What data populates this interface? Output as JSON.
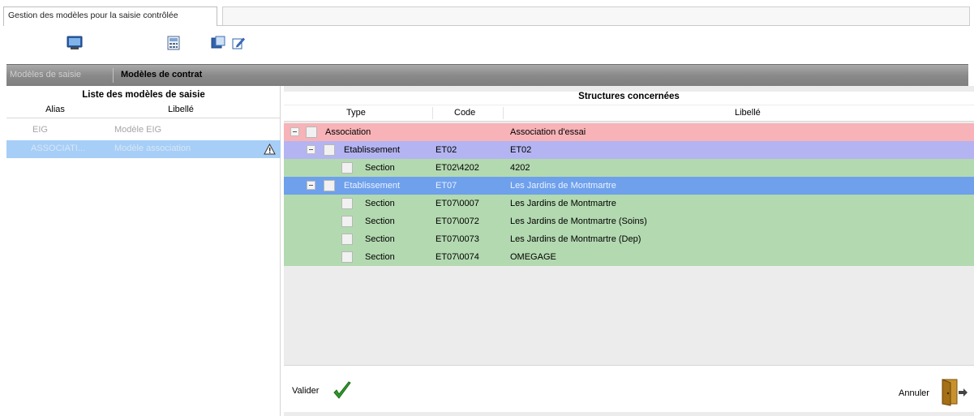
{
  "window": {
    "title": "Gestion des modèles pour la saisie contrôlée"
  },
  "toolbar": {
    "icons": [
      "monitor-icon",
      "calculator-icon",
      "window-icon",
      "edit-icon"
    ]
  },
  "tabs": [
    {
      "label": "Modèles de saisie",
      "active": false
    },
    {
      "label": "Modèles de contrat",
      "active": true
    }
  ],
  "left_panel": {
    "title": "Liste des modèles de saisie",
    "columns": [
      "Alias",
      "Libellé"
    ],
    "rows": [
      {
        "alias": "EIG",
        "libelle": "Modèle EIG",
        "selected": false
      },
      {
        "alias": "ASSOCIATI...",
        "libelle": "Modèle association",
        "selected": true,
        "warning": true
      }
    ]
  },
  "right_panel": {
    "title": "Structures  concernées",
    "columns": [
      "Type",
      "Code",
      "Libellé"
    ],
    "rows": [
      {
        "level": 0,
        "type": "Association",
        "code": "",
        "libelle": "Association d'essai",
        "kind": "assoc",
        "expander": true
      },
      {
        "level": 1,
        "type": "Etablissement",
        "code": "ET02",
        "libelle": "ET02",
        "kind": "etab",
        "expander": true
      },
      {
        "level": 2,
        "type": "Section",
        "code": "ET02\\4202",
        "libelle": "4202",
        "kind": "sect",
        "expander": false
      },
      {
        "level": 1,
        "type": "Etablissement",
        "code": "ET07",
        "libelle": "Les Jardins de Montmartre",
        "kind": "sel",
        "expander": true
      },
      {
        "level": 2,
        "type": "Section",
        "code": "ET07\\0007",
        "libelle": "Les Jardins de Montmartre",
        "kind": "sect",
        "expander": false
      },
      {
        "level": 2,
        "type": "Section",
        "code": "ET07\\0072",
        "libelle": "Les Jardins de Montmartre (Soins)",
        "kind": "sect",
        "expander": false
      },
      {
        "level": 2,
        "type": "Section",
        "code": "ET07\\0073",
        "libelle": "Les Jardins de Montmartre (Dep)",
        "kind": "sect",
        "expander": false
      },
      {
        "level": 2,
        "type": "Section",
        "code": "ET07\\0074",
        "libelle": "OMEGAGE",
        "kind": "sect",
        "expander": false
      }
    ]
  },
  "actions": {
    "valider": "Valider",
    "annuler": "Annuler"
  },
  "colors": {
    "association": "#f7b3b7",
    "etablissement": "#b4b4f2",
    "section": "#b3d9b0",
    "selected": "#6ea0ec"
  }
}
